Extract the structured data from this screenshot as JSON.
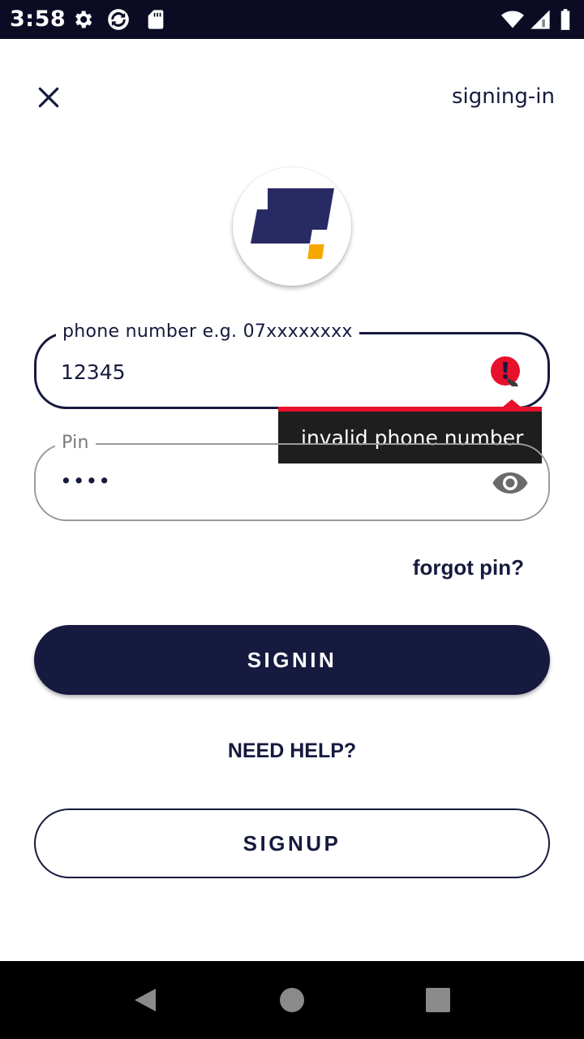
{
  "status_bar": {
    "time": "3:58",
    "icons": [
      "gear-icon",
      "sync-icon",
      "sd-card-icon",
      "wifi-icon",
      "signal-icon",
      "battery-icon"
    ]
  },
  "header": {
    "title": "signing-in",
    "close_icon": "close-icon"
  },
  "logo": {
    "colors": {
      "navy": "#272a63",
      "accent": "#f5a800"
    }
  },
  "phone_field": {
    "label": "phone number e.g. 07xxxxxxxx",
    "value": "12345",
    "error_icon": "error-icon",
    "error_message": "invalid phone number"
  },
  "pin_field": {
    "label": "Pin",
    "value": "••••",
    "toggle_icon": "eye-icon"
  },
  "links": {
    "forgot_pin": "forgot pin?",
    "need_help": "NEED HELP?"
  },
  "buttons": {
    "signin": "SIGNIN",
    "signup": "SIGNUP"
  },
  "nav_bar": {
    "icons": [
      "back-icon",
      "home-icon",
      "recents-icon"
    ]
  },
  "colors": {
    "primary": "#161a3e",
    "error": "#e8112d",
    "tooltip_bg": "#1e1e1e"
  }
}
